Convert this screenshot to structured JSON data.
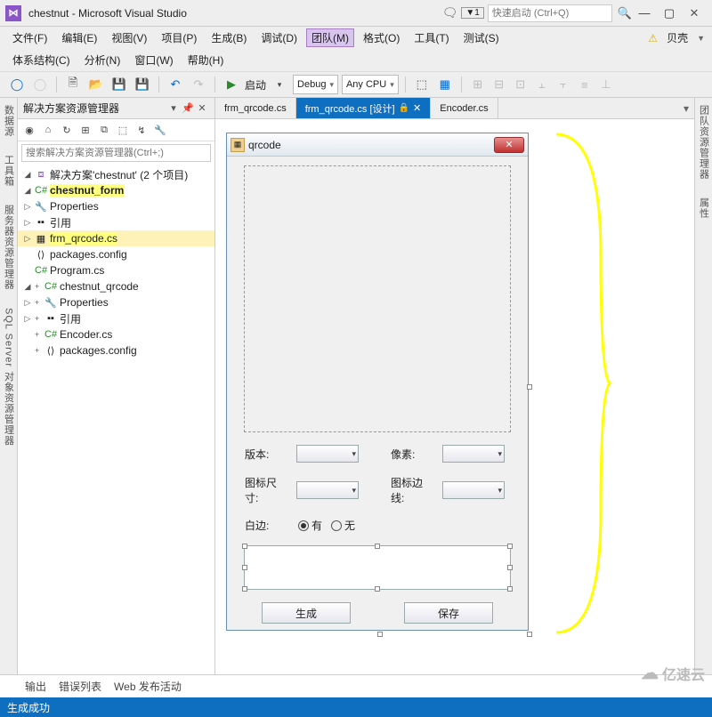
{
  "titlebar": {
    "app_title": "chestnut - Microsoft Visual Studio",
    "quicklaunch_placeholder": "快速启动 (Ctrl+Q)",
    "notif_count": "1"
  },
  "menu1": {
    "file": "文件(F)",
    "edit": "编辑(E)",
    "view": "视图(V)",
    "project": "项目(P)",
    "build": "生成(B)",
    "debug": "调试(D)",
    "team": "团队(M)",
    "format": "格式(O)",
    "tools": "工具(T)",
    "test": "测试(S)",
    "shell": "贝壳 "
  },
  "menu2": {
    "arch": "体系结构(C)",
    "analyze": "分析(N)",
    "window": "窗口(W)",
    "help": "帮助(H)"
  },
  "toolbar": {
    "start": "启动",
    "config": "Debug",
    "platform": "Any CPU"
  },
  "leftrail": {
    "t1": "数据源",
    "t2": "工具箱",
    "t3": "服务器资源管理器",
    "t4": "SQL Server 对象资源管理器"
  },
  "rightrail": {
    "t1": "团队资源管理器",
    "t2": "属性"
  },
  "solexp": {
    "title": "解决方案资源管理器",
    "search_placeholder": "搜索解决方案资源管理器(Ctrl+;)",
    "solution": "解决方案'chestnut' (2 个项目)",
    "proj1": "chestnut_form",
    "p1_properties": "Properties",
    "p1_refs": "引用",
    "p1_frm": "frm_qrcode.cs",
    "p1_pkg": "packages.config",
    "p1_prog": "Program.cs",
    "proj2": "chestnut_qrcode",
    "p2_properties": "Properties",
    "p2_refs": "引用",
    "p2_enc": "Encoder.cs",
    "p2_pkg": "packages.config"
  },
  "tabs": {
    "t1": "frm_qrcode.cs",
    "t2": "frm_qrcode.cs [设计]",
    "t3": "Encoder.cs"
  },
  "form": {
    "title": "qrcode",
    "version": "版本:",
    "pixel": "像素:",
    "iconsize": "图标尺寸:",
    "iconborder": "图标边线:",
    "margin": "白边:",
    "yes": "有",
    "no": "无",
    "gen": "生成",
    "save": "保存"
  },
  "bottom": {
    "output": "输出",
    "errors": "错误列表",
    "webpub": "Web 发布活动"
  },
  "status": {
    "msg": "生成成功"
  },
  "watermark": {
    "text": "亿速云"
  }
}
